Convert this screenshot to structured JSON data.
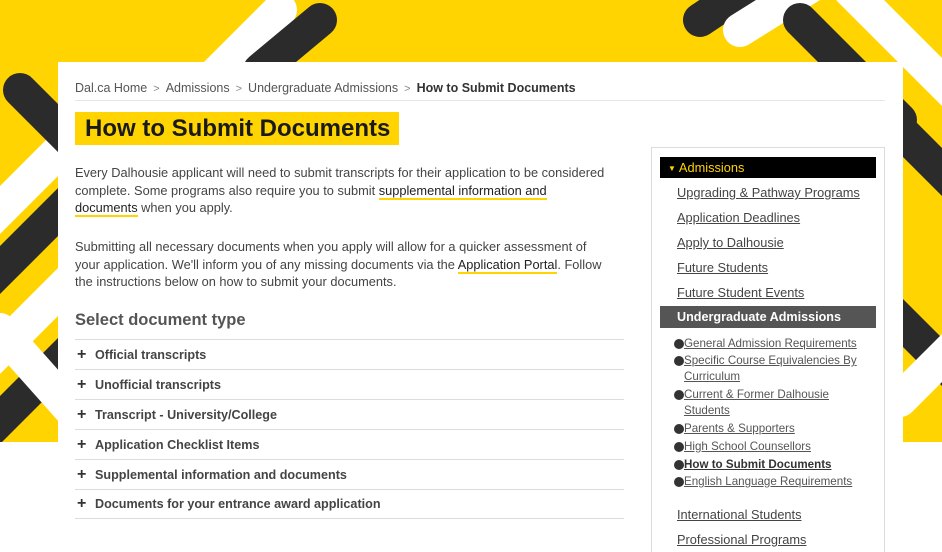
{
  "breadcrumb": {
    "items": [
      "Dal.ca Home",
      "Admissions",
      "Undergraduate Admissions"
    ],
    "current": "How to Submit Documents",
    "separator": ">"
  },
  "page": {
    "title": "How to Submit Documents",
    "intro1_text": "Every Dalhousie applicant will need to submit transcripts for their application to be considered complete. Some programs also require you to submit ",
    "intro1_link": "supplemental information and documents",
    "intro1_tail": " when you apply.",
    "intro2_text": "Submitting all necessary documents when you apply will allow for a quicker assessment of your application. We'll inform you of any missing documents via the ",
    "intro2_link": "Application Portal",
    "intro2_tail": ". Follow the instructions below on how to submit your documents.",
    "section_title": "Select document type"
  },
  "accordion": {
    "expand_glyph": "+",
    "items": [
      "Official transcripts",
      "Unofficial transcripts",
      "Transcript - University/College",
      "Application Checklist Items",
      "Supplemental information and documents",
      "Documents for your entrance award application"
    ]
  },
  "sidebar": {
    "head": "Admissions",
    "links": [
      "Upgrading & Pathway Programs",
      "Application Deadlines",
      "Apply to Dalhousie",
      "Future Students",
      "Future Student Events"
    ],
    "active": "Undergraduate Admissions",
    "sub": [
      "General Admission Requirements",
      "Specific Course Equivalencies By Curriculum",
      "Current & Former Dalhousie Students",
      "Parents & Supporters",
      "High School Counsellors",
      "How to Submit Documents",
      "English Language Requirements"
    ],
    "links_after": [
      "International Students",
      "Professional Programs"
    ]
  },
  "colors": {
    "brand_yellow": "#ffd400",
    "dark": "#242424",
    "active_bg": "#555555"
  }
}
